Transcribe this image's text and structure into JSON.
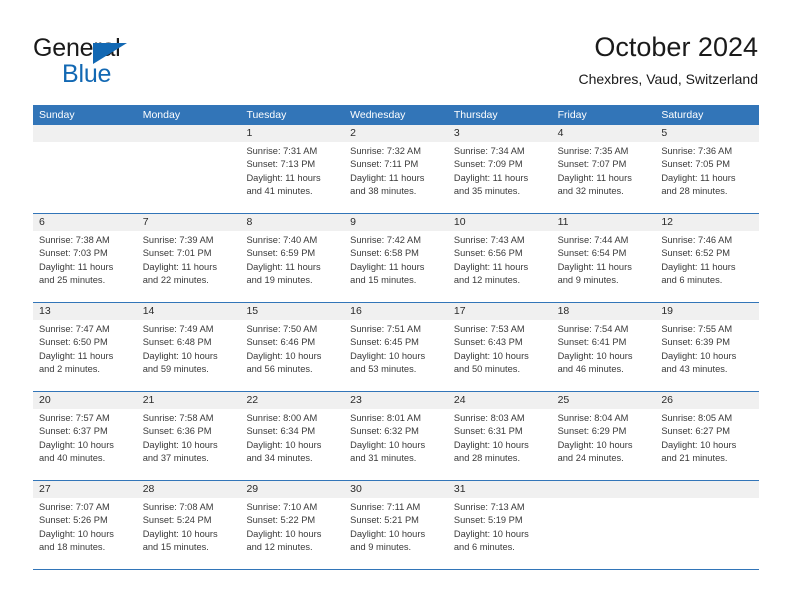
{
  "brand": {
    "name_part1": "General",
    "name_part2": "Blue",
    "color_black": "#1a1a1a",
    "color_blue": "#1268b3"
  },
  "header": {
    "title": "October 2024",
    "subtitle": "Chexbres, Vaud, Switzerland"
  },
  "theme": {
    "header_blue": "#3275b8",
    "daynum_band": "#f0f0f0",
    "text": "#2b2b2b"
  },
  "weekdays": [
    "Sunday",
    "Monday",
    "Tuesday",
    "Wednesday",
    "Thursday",
    "Friday",
    "Saturday"
  ],
  "weeks": [
    [
      {
        "day": "",
        "lines": []
      },
      {
        "day": "",
        "lines": []
      },
      {
        "day": "1",
        "lines": [
          "Sunrise: 7:31 AM",
          "Sunset: 7:13 PM",
          "Daylight: 11 hours",
          "and 41 minutes."
        ]
      },
      {
        "day": "2",
        "lines": [
          "Sunrise: 7:32 AM",
          "Sunset: 7:11 PM",
          "Daylight: 11 hours",
          "and 38 minutes."
        ]
      },
      {
        "day": "3",
        "lines": [
          "Sunrise: 7:34 AM",
          "Sunset: 7:09 PM",
          "Daylight: 11 hours",
          "and 35 minutes."
        ]
      },
      {
        "day": "4",
        "lines": [
          "Sunrise: 7:35 AM",
          "Sunset: 7:07 PM",
          "Daylight: 11 hours",
          "and 32 minutes."
        ]
      },
      {
        "day": "5",
        "lines": [
          "Sunrise: 7:36 AM",
          "Sunset: 7:05 PM",
          "Daylight: 11 hours",
          "and 28 minutes."
        ]
      }
    ],
    [
      {
        "day": "6",
        "lines": [
          "Sunrise: 7:38 AM",
          "Sunset: 7:03 PM",
          "Daylight: 11 hours",
          "and 25 minutes."
        ]
      },
      {
        "day": "7",
        "lines": [
          "Sunrise: 7:39 AM",
          "Sunset: 7:01 PM",
          "Daylight: 11 hours",
          "and 22 minutes."
        ]
      },
      {
        "day": "8",
        "lines": [
          "Sunrise: 7:40 AM",
          "Sunset: 6:59 PM",
          "Daylight: 11 hours",
          "and 19 minutes."
        ]
      },
      {
        "day": "9",
        "lines": [
          "Sunrise: 7:42 AM",
          "Sunset: 6:58 PM",
          "Daylight: 11 hours",
          "and 15 minutes."
        ]
      },
      {
        "day": "10",
        "lines": [
          "Sunrise: 7:43 AM",
          "Sunset: 6:56 PM",
          "Daylight: 11 hours",
          "and 12 minutes."
        ]
      },
      {
        "day": "11",
        "lines": [
          "Sunrise: 7:44 AM",
          "Sunset: 6:54 PM",
          "Daylight: 11 hours",
          "and 9 minutes."
        ]
      },
      {
        "day": "12",
        "lines": [
          "Sunrise: 7:46 AM",
          "Sunset: 6:52 PM",
          "Daylight: 11 hours",
          "and 6 minutes."
        ]
      }
    ],
    [
      {
        "day": "13",
        "lines": [
          "Sunrise: 7:47 AM",
          "Sunset: 6:50 PM",
          "Daylight: 11 hours",
          "and 2 minutes."
        ]
      },
      {
        "day": "14",
        "lines": [
          "Sunrise: 7:49 AM",
          "Sunset: 6:48 PM",
          "Daylight: 10 hours",
          "and 59 minutes."
        ]
      },
      {
        "day": "15",
        "lines": [
          "Sunrise: 7:50 AM",
          "Sunset: 6:46 PM",
          "Daylight: 10 hours",
          "and 56 minutes."
        ]
      },
      {
        "day": "16",
        "lines": [
          "Sunrise: 7:51 AM",
          "Sunset: 6:45 PM",
          "Daylight: 10 hours",
          "and 53 minutes."
        ]
      },
      {
        "day": "17",
        "lines": [
          "Sunrise: 7:53 AM",
          "Sunset: 6:43 PM",
          "Daylight: 10 hours",
          "and 50 minutes."
        ]
      },
      {
        "day": "18",
        "lines": [
          "Sunrise: 7:54 AM",
          "Sunset: 6:41 PM",
          "Daylight: 10 hours",
          "and 46 minutes."
        ]
      },
      {
        "day": "19",
        "lines": [
          "Sunrise: 7:55 AM",
          "Sunset: 6:39 PM",
          "Daylight: 10 hours",
          "and 43 minutes."
        ]
      }
    ],
    [
      {
        "day": "20",
        "lines": [
          "Sunrise: 7:57 AM",
          "Sunset: 6:37 PM",
          "Daylight: 10 hours",
          "and 40 minutes."
        ]
      },
      {
        "day": "21",
        "lines": [
          "Sunrise: 7:58 AM",
          "Sunset: 6:36 PM",
          "Daylight: 10 hours",
          "and 37 minutes."
        ]
      },
      {
        "day": "22",
        "lines": [
          "Sunrise: 8:00 AM",
          "Sunset: 6:34 PM",
          "Daylight: 10 hours",
          "and 34 minutes."
        ]
      },
      {
        "day": "23",
        "lines": [
          "Sunrise: 8:01 AM",
          "Sunset: 6:32 PM",
          "Daylight: 10 hours",
          "and 31 minutes."
        ]
      },
      {
        "day": "24",
        "lines": [
          "Sunrise: 8:03 AM",
          "Sunset: 6:31 PM",
          "Daylight: 10 hours",
          "and 28 minutes."
        ]
      },
      {
        "day": "25",
        "lines": [
          "Sunrise: 8:04 AM",
          "Sunset: 6:29 PM",
          "Daylight: 10 hours",
          "and 24 minutes."
        ]
      },
      {
        "day": "26",
        "lines": [
          "Sunrise: 8:05 AM",
          "Sunset: 6:27 PM",
          "Daylight: 10 hours",
          "and 21 minutes."
        ]
      }
    ],
    [
      {
        "day": "27",
        "lines": [
          "Sunrise: 7:07 AM",
          "Sunset: 5:26 PM",
          "Daylight: 10 hours",
          "and 18 minutes."
        ]
      },
      {
        "day": "28",
        "lines": [
          "Sunrise: 7:08 AM",
          "Sunset: 5:24 PM",
          "Daylight: 10 hours",
          "and 15 minutes."
        ]
      },
      {
        "day": "29",
        "lines": [
          "Sunrise: 7:10 AM",
          "Sunset: 5:22 PM",
          "Daylight: 10 hours",
          "and 12 minutes."
        ]
      },
      {
        "day": "30",
        "lines": [
          "Sunrise: 7:11 AM",
          "Sunset: 5:21 PM",
          "Daylight: 10 hours",
          "and 9 minutes."
        ]
      },
      {
        "day": "31",
        "lines": [
          "Sunrise: 7:13 AM",
          "Sunset: 5:19 PM",
          "Daylight: 10 hours",
          "and 6 minutes."
        ]
      },
      {
        "day": "",
        "lines": []
      },
      {
        "day": "",
        "lines": []
      }
    ]
  ]
}
